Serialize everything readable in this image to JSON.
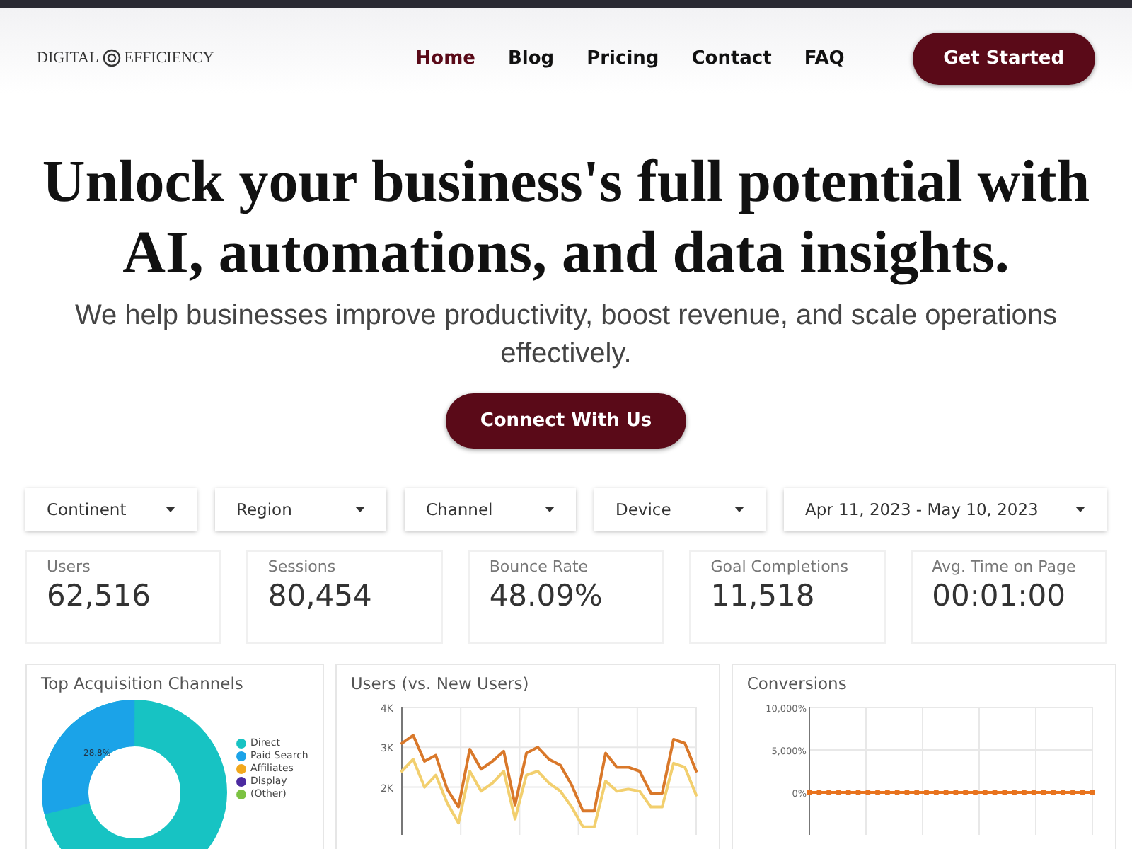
{
  "header": {
    "logo": {
      "left": "DIGITAL",
      "right": "EFFICIENCY"
    },
    "nav": [
      {
        "label": "Home",
        "selected": true
      },
      {
        "label": "Blog",
        "selected": false
      },
      {
        "label": "Pricing",
        "selected": false
      },
      {
        "label": "Contact",
        "selected": false
      },
      {
        "label": "FAQ",
        "selected": false
      }
    ],
    "cta": "Get Started"
  },
  "hero": {
    "title_lines": [
      "Unlock your business's full potential with",
      "AI, automations, and data insights."
    ],
    "subtitle": "We help businesses improve productivity, boost revenue, and scale operations effectively.",
    "button": "Connect With Us"
  },
  "dashboard": {
    "filters": [
      {
        "label": "Continent"
      },
      {
        "label": "Region"
      },
      {
        "label": "Channel"
      },
      {
        "label": "Device"
      },
      {
        "label": "Apr 11, 2023 - May 10, 2023"
      }
    ],
    "stats": [
      {
        "label": "Users",
        "value": "62,516"
      },
      {
        "label": "Sessions",
        "value": "80,454"
      },
      {
        "label": "Bounce Rate",
        "value": "48.09%"
      },
      {
        "label": "Goal Completions",
        "value": "11,518"
      },
      {
        "label": "Avg. Time on Page",
        "value": "00:01:00"
      }
    ],
    "acquisition": {
      "title": "Top Acquisition Channels",
      "slice_label": "28.8%",
      "legend": [
        {
          "label": "Direct",
          "color": "#17c3c3"
        },
        {
          "label": "Paid Search",
          "color": "#1ba3e8"
        },
        {
          "label": "Affiliates",
          "color": "#f2a81d"
        },
        {
          "label": "Display",
          "color": "#4b2aa0"
        },
        {
          "label": "(Other)",
          "color": "#7cc242"
        }
      ]
    },
    "users_chart": {
      "title": "Users (vs. New Users)",
      "chart_data": {
        "type": "line",
        "grid": true,
        "ylim": [
          800,
          4000
        ],
        "yticks": [
          {
            "value": 2000,
            "label": "2K"
          },
          {
            "value": 3000,
            "label": "3K"
          },
          {
            "value": 4000,
            "label": "4K"
          }
        ],
        "series": [
          {
            "color": "#d9782a",
            "values": [
              3100,
              3300,
              2650,
              2800,
              1950,
              1500,
              2950,
              2450,
              2650,
              2900,
              1550,
              2850,
              3000,
              2700,
              2550,
              2050,
              1400,
              1400,
              2850,
              2500,
              2500,
              2400,
              1850,
              1850,
              3200,
              3100,
              2400
            ]
          },
          {
            "color": "#f2cf6e",
            "values": [
              2400,
              2700,
              2000,
              2300,
              1600,
              1100,
              2400,
              1900,
              2100,
              2400,
              1200,
              2300,
              2400,
              2100,
              1900,
              1500,
              1000,
              1000,
              2150,
              1900,
              1950,
              1900,
              1500,
              1500,
              2600,
              2500,
              1800
            ]
          }
        ]
      }
    },
    "conversions_chart": {
      "title": "Conversions",
      "chart_data": {
        "type": "line",
        "grid": true,
        "ylim": [
          -5000,
          10000
        ],
        "yticks": [
          {
            "value": 0,
            "label": "0%"
          },
          {
            "value": 5000,
            "label": "5,000%"
          },
          {
            "value": 10000,
            "label": "10,000%"
          }
        ],
        "series": [
          {
            "color": "#e8731e",
            "marker": true,
            "values": [
              0,
              0,
              0,
              0,
              0,
              0,
              0,
              0,
              0,
              0,
              0,
              0,
              0,
              0,
              0,
              0,
              0,
              0,
              0,
              0,
              0,
              0,
              0,
              0,
              0,
              0,
              0,
              0,
              0,
              0
            ]
          }
        ]
      }
    }
  }
}
